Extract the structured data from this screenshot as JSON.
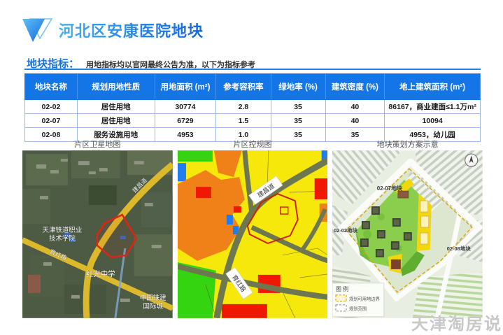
{
  "page": {
    "title": "河北区安康医院地块",
    "section": {
      "label": "地块指标：",
      "note": "用地指标均以官网最终公告为准，以下为指标参考"
    },
    "watermark": "天津淘房说"
  },
  "table": {
    "headers": [
      "地块名称",
      "规划用地性质",
      "用地面积 (m²)",
      "参考容积率",
      "绿地率 (%)",
      "建筑密度 (%)",
      "地上建筑面积 (m²)"
    ],
    "rows": [
      {
        "name": "02-02",
        "use": "居住用地",
        "area": "30774",
        "far": "2.8",
        "green": "35",
        "density": "40",
        "gfa": "86167，商业建面≤1.1万m²"
      },
      {
        "name": "02-07",
        "use": "居住用地",
        "area": "6729",
        "far": "1.5",
        "green": "35",
        "density": "40",
        "gfa": "10094"
      },
      {
        "name": "02-08",
        "use": "服务设施用地",
        "area": "4953",
        "far": "1.0",
        "green": "35",
        "density": "35",
        "gfa": "4953，幼儿园"
      }
    ]
  },
  "captions": {
    "satellite": "片区卫星地图",
    "zoning": "片区控规图",
    "plan": "地块策划方案示意"
  },
  "satellite_map": {
    "college_line1": "天津铁道职业",
    "college_line2": "技术学院",
    "school": "红光中学",
    "complex_line1": "中国铁建",
    "complex_line2": "国际城",
    "road_top": "建昌道",
    "road_bottom": "育红路"
  },
  "zoning_map": {
    "road_top": "建昌道",
    "road_bottom": "育红路"
  },
  "plan_map": {
    "parcel_07": "02-07地块",
    "parcel_02": "02-02地块",
    "parcel_08": "02-08地块",
    "legend_title": "图 例",
    "legend_boundary": "规划可用地边界",
    "legend_scope": "规划范围"
  },
  "colors": {
    "accent_blue": "#1375e6",
    "parcel_outline_red": "#e3230f",
    "road_yellow": "#dcb92a",
    "zone_yellow": "#f5e80a",
    "zone_orange": "#f08018",
    "zone_green": "#35d410",
    "zone_red": "#f01800",
    "zone_blue": "#1f7df0",
    "plan_green": "#8bce4d"
  }
}
